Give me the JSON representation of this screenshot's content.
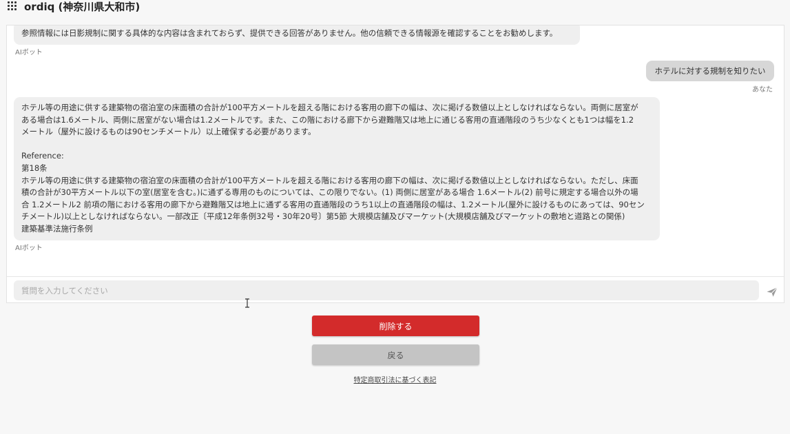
{
  "header": {
    "title": "ordiq (神奈川県大和市)",
    "menu_icon": "grid-menu-icon"
  },
  "chat": {
    "messages": [
      {
        "role": "bot",
        "text": "参照情報には日影規制に関する具体的な内容は含まれておらず、提供できる回答がありません。他の信頼できる情報源を確認することをお勧めします。",
        "sender": "AIボット"
      },
      {
        "role": "user",
        "text": "ホテルに対する規制を知りたい",
        "sender": "あなた"
      },
      {
        "role": "bot",
        "answer_lines": [
          "ホテル等の用途に供する建築物の宿泊室の床面積の合計が100平方メートルを超える階における客用の廊下の幅は、次に掲げる数値以上としなければならない。両側に居室が",
          "ある場合は1.6メートル、両側に居室がない場合は1.2メートルです。また、この階における廊下から避難階又は地上に通じる客用の直通階段のうち少なくとも1つは幅を1.2",
          "メートル（屋外に設けるものは90センチメートル）以上確保する必要があります。"
        ],
        "reference_label": "Reference:",
        "reference_article": "第18条",
        "reference_lines": [
          "ホテル等の用途に供する建築物の宿泊室の床面積の合計が100平方メートルを超える階における客用の廊下の幅は、次に掲げる数値以上としなければならない。ただし、床面",
          "積の合計が30平方メートル以下の室(居室を含む。)に通ずる専用のものについては、この限りでない。(1) 両側に居室がある場合 1.6メートル(2) 前号に規定する場合以外の場",
          "合 1.2メートル2 前項の階における客用の廊下から避難階又は地上に通ずる客用の直通階段のうち1以上の直通階段の幅は、1.2メートル(屋外に設けるものにあっては、90セン",
          "チメートル)以上としなければならない。一部改正〔平成12年条例32号・30年20号〕第5節 大規模店舗及びマーケット(大規模店舗及びマーケットの敷地と道路との関係)",
          "建築基準法施行条例"
        ],
        "sender": "AIボット"
      }
    ],
    "input_placeholder": "質問を入力してください",
    "input_value": "",
    "send_icon": "send-icon"
  },
  "actions": {
    "delete_label": "削除する",
    "back_label": "戻る",
    "legal_link": "特定商取引法に基づく表記"
  },
  "colors": {
    "delete_button": "#d32b2b",
    "back_button": "#c4c4c4",
    "bot_bubble": "#efefef",
    "user_bubble": "#d7d7d7"
  }
}
